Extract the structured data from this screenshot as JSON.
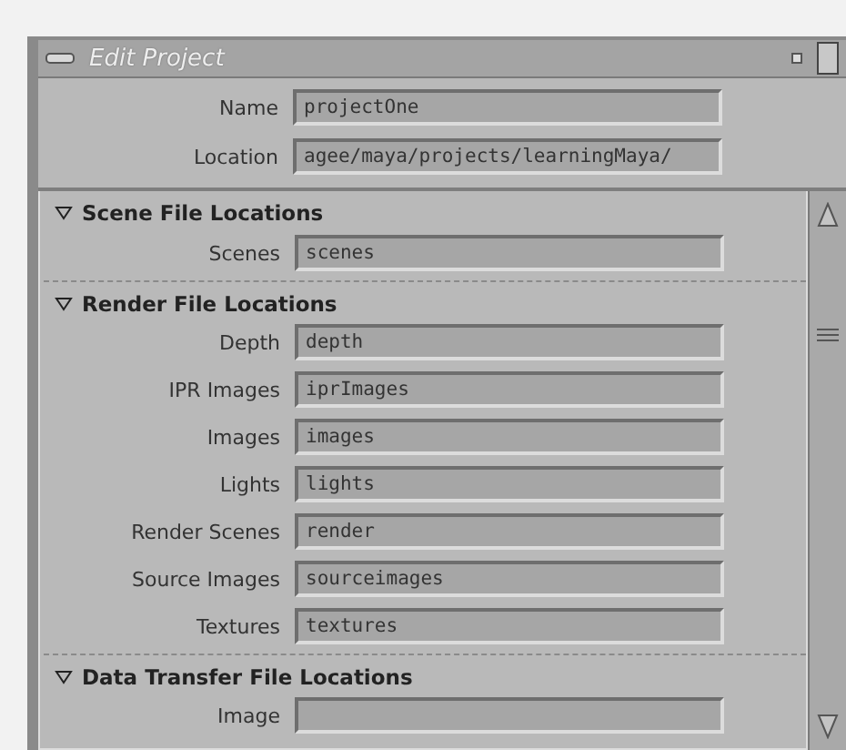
{
  "window": {
    "title": "Edit Project"
  },
  "fields": [
    {
      "label": "Name",
      "value": "projectOne"
    },
    {
      "label": "Location",
      "value": "agee/maya/projects/learningMaya/"
    }
  ],
  "sections": [
    {
      "title": "Scene File Locations",
      "expanded": true,
      "rows": [
        {
          "label": "Scenes",
          "value": "scenes"
        }
      ]
    },
    {
      "title": "Render File Locations",
      "expanded": true,
      "rows": [
        {
          "label": "Depth",
          "value": "depth"
        },
        {
          "label": "IPR Images",
          "value": "iprImages"
        },
        {
          "label": "Images",
          "value": "images"
        },
        {
          "label": "Lights",
          "value": "lights"
        },
        {
          "label": "Render Scenes",
          "value": "render"
        },
        {
          "label": "Source Images",
          "value": "sourceimages"
        },
        {
          "label": "Textures",
          "value": "textures"
        }
      ]
    },
    {
      "title": "Data Transfer File Locations",
      "expanded": true,
      "rows": [
        {
          "label": "Image"
        }
      ]
    }
  ]
}
